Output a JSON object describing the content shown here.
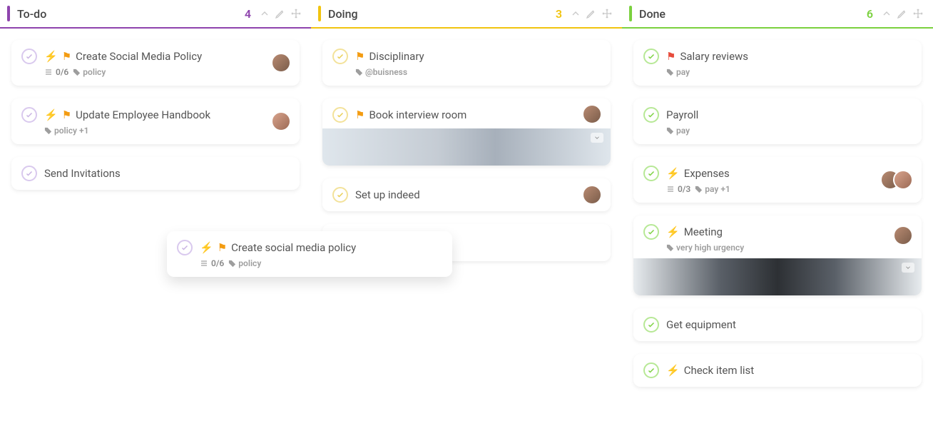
{
  "columns": [
    {
      "id": "todo",
      "title": "To-do",
      "count": "4"
    },
    {
      "id": "doing",
      "title": "Doing",
      "count": "3"
    },
    {
      "id": "done",
      "title": "Done",
      "count": "6"
    }
  ],
  "todo": {
    "c0": {
      "title": "Create Social Media Policy",
      "subtasks": "0/6",
      "tag": "policy"
    },
    "c1": {
      "title": "Update Employee Handbook",
      "tag": "policy +1"
    },
    "c2": {
      "title": "Send Invitations"
    },
    "drag": {
      "title": "Create social media policy",
      "subtasks": "0/6",
      "tag": "policy"
    }
  },
  "doing": {
    "c0": {
      "title": "Disciplinary",
      "tag": "@buisness"
    },
    "c1": {
      "title": "Book interview room"
    },
    "c2": {
      "title": "Set up indeed"
    }
  },
  "done": {
    "c0": {
      "title": "Salary reviews",
      "tag": "pay"
    },
    "c1": {
      "title": "Payroll",
      "tag": "pay"
    },
    "c2": {
      "title": "Expenses",
      "subtasks": "0/3",
      "tag": "pay +1"
    },
    "c3": {
      "title": "Meeting",
      "tag": "very high urgency"
    },
    "c4": {
      "title": "Get equipment"
    },
    "c5": {
      "title": "Check item list"
    }
  }
}
